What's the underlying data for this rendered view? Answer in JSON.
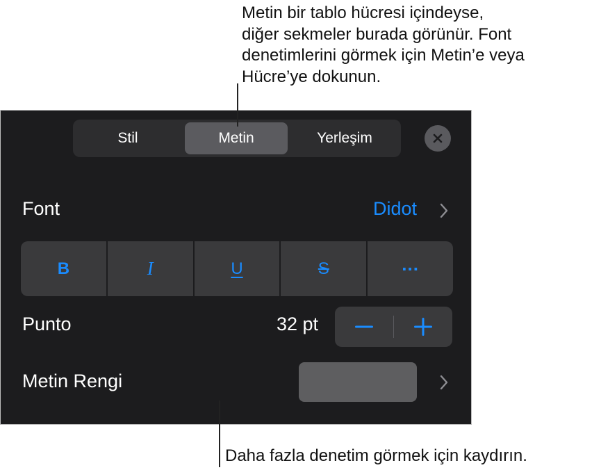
{
  "callouts": {
    "top": "Metin bir tablo hücresi içindeyse,\ndiğer sekmeler burada görünür. Font\ndenetimlerini görmek için Metin’e veya\nHücre’ye dokunun.",
    "bottom": "Daha fazla denetim görmek için kaydırın."
  },
  "tabs": [
    {
      "label": "Stil",
      "active": false
    },
    {
      "label": "Metin",
      "active": true
    },
    {
      "label": "Yerleşim",
      "active": false
    }
  ],
  "font": {
    "label": "Font",
    "value": "Didot"
  },
  "style_buttons": {
    "bold": "B",
    "italic": "I",
    "underline": "U",
    "strikethrough": "S",
    "more": "..."
  },
  "size": {
    "label": "Punto",
    "value": "32 pt"
  },
  "text_color": {
    "label": "Metin Rengi",
    "swatch": "#5e5e60"
  },
  "colors": {
    "panel": "#1c1c1e",
    "accent": "#1a8cff",
    "control": "#3a3a3c",
    "active_tab": "#5b5b5f"
  },
  "icons": {
    "close": "close-icon",
    "chevron": "chevron-right-icon",
    "minus": "minus-icon",
    "plus": "plus-icon"
  }
}
